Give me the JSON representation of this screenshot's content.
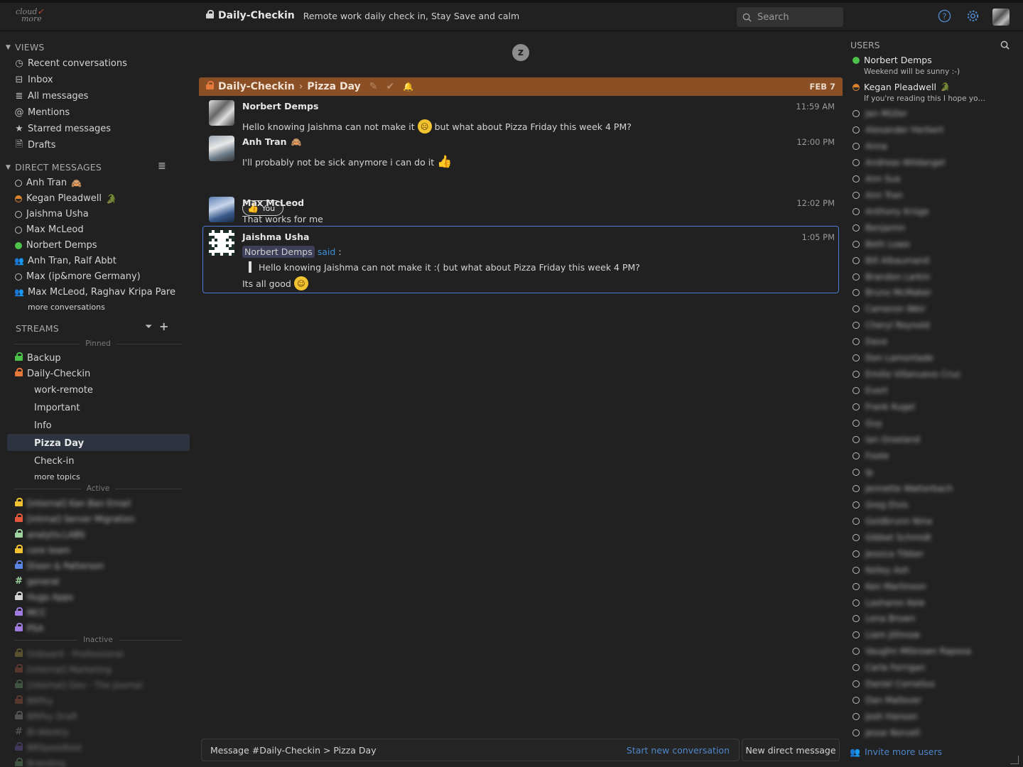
{
  "app": {
    "logo_line1": "cloud",
    "logo_line2": "more"
  },
  "header": {
    "stream_name": "Daily-Checkin",
    "stream_description": "Remote work  daily check in, Stay Save and calm",
    "search_placeholder": "Search"
  },
  "sidebar": {
    "views_title": "VIEWS",
    "views": [
      {
        "label": "Recent conversations",
        "icon": "clock-icon"
      },
      {
        "label": "Inbox",
        "icon": "inbox-icon"
      },
      {
        "label": "All messages",
        "icon": "list-icon"
      },
      {
        "label": "Mentions",
        "icon": "at-icon"
      },
      {
        "label": "Starred messages",
        "icon": "star-icon"
      },
      {
        "label": "Drafts",
        "icon": "draft-icon"
      }
    ],
    "dm_title": "DIRECT MESSAGES",
    "dms": [
      {
        "label": "Anh Tran",
        "status": "offline",
        "emoji": "🙈"
      },
      {
        "label": "Kegan Pleadwell",
        "status": "idle",
        "emoji": "🐊"
      },
      {
        "label": "Jaishma Usha",
        "status": "offline"
      },
      {
        "label": "Max McLeod",
        "status": "offline"
      },
      {
        "label": "Norbert Demps",
        "status": "active"
      },
      {
        "label": "Anh Tran, Ralf Abbt",
        "status": "group"
      },
      {
        "label": "Max (ip&more Germany)",
        "status": "offline"
      },
      {
        "label": "Max McLeod, Raghav Kripa Pare",
        "status": "group"
      }
    ],
    "more_conversations": "more conversations",
    "streams_title": "STREAMS",
    "pinned_label": "Pinned",
    "pinned_streams": [
      {
        "label": "Backup",
        "color": "#4cc24a"
      },
      {
        "label": "Daily-Checkin",
        "color": "#e5793a"
      }
    ],
    "topics": [
      "work-remote",
      "Important",
      "Info",
      "Pizza Day",
      "Check-in"
    ],
    "selected_topic": "Pizza Day",
    "more_topics": "more topics",
    "active_label": "Active",
    "active_streams": [
      {
        "label": "[internal] Kan Ban Email",
        "color": "#f2c230"
      },
      {
        "label": "[intrnal] Server Migration",
        "color": "#e5563a"
      },
      {
        "label": "analytiv.LABS",
        "color": "#9fd3a0"
      },
      {
        "label": "core team",
        "color": "#f2c230"
      },
      {
        "label": "Dixon & Patterson",
        "color": "#5b86e5"
      },
      {
        "label": "general",
        "color": "#9fd3a0",
        "hash": true
      },
      {
        "label": "Hugo Apps",
        "color": "#d4d4d4"
      },
      {
        "label": "MCC",
        "color": "#a07be0"
      },
      {
        "label": "PSA",
        "color": "#a07be0"
      }
    ],
    "inactive_label": "Inactive",
    "inactive_streams": [
      {
        "label": "Onboard - Professional",
        "color": "#8a7a3a"
      },
      {
        "label": "[internal] Marketing",
        "color": "#8a4a3a"
      },
      {
        "label": "[internal] Dev - The Journal",
        "color": "#5a7a5a"
      },
      {
        "label": "BRPsy",
        "color": "#8a4a3a"
      },
      {
        "label": "BRPsy Draft",
        "color": "#7a7a7a"
      },
      {
        "label": "Bi-Weekly",
        "color": "#7a7a7a",
        "hash": true
      },
      {
        "label": "BRSpeedtest",
        "color": "#5a4a8a"
      },
      {
        "label": "Branding",
        "color": "#5a7a5a"
      }
    ]
  },
  "recipient_bar": {
    "stream": "Daily-Checkin",
    "topic": "Pizza Day",
    "date": "FEB 7"
  },
  "messages": [
    {
      "sender": "Norbert Demps",
      "time": "11:59 AM",
      "text_before": "Hello knowing Jaishma can not make it",
      "text_after": "but what about Pizza Friday this week 4 PM?"
    },
    {
      "sender": "Anh Tran",
      "time": "12:00 PM",
      "text": "I'll probably not be sick anymore i can do it",
      "reaction_label": "You"
    },
    {
      "sender": "Max McLeod",
      "time": "12:02 PM",
      "text": "That works for me"
    },
    {
      "sender": "Jaishma Usha",
      "time": "1:05 PM",
      "mention": "Norbert Demps",
      "said": "said",
      "quote": "Hello knowing Jaishma can not make it :( but what about Pizza Friday this week 4 PM?",
      "text": "Its all good"
    }
  ],
  "compose": {
    "placeholder": "Message #Daily-Checkin > Pizza Day",
    "start_new": "Start new conversation",
    "new_dm": "New direct message"
  },
  "users_panel": {
    "title": "USERS",
    "users": [
      {
        "name": "Norbert Demps",
        "status": "active",
        "sub": "Weekend will be sunny :-)"
      },
      {
        "name": "Kegan Pleadwell",
        "status": "idle",
        "sub": "If you're reading this I hope yo…",
        "emoji": "🐊"
      }
    ],
    "offline_users": [
      "Jan Müller",
      "Alexander Herbert",
      "Anna",
      "Andreas Wildangel",
      "Ann Sue",
      "Ann Tran",
      "Anthony Krüge",
      "Benjamin",
      "Beth Lowe",
      "Bill Albaumanit",
      "Brandon Larkin",
      "Bruno McMaker",
      "Cameron Weir",
      "Cheryl Reynold",
      "Dave",
      "Don Lamontade",
      "Emilio Villanuevo Cruz",
      "Evert",
      "Frank Kugel",
      "Guy",
      "Ian Groeland",
      "Foote",
      "Ip",
      "Jennette Watterbach",
      "Greg Elvis",
      "Goldbrunn Nina",
      "Gibbet Schmidt",
      "Jessica Tibber",
      "Kelley Ash",
      "Ken Martinson",
      "Lasharon Kele",
      "Lena Brown",
      "Liam Jithnow",
      "Vaughn Mtbrown Raposa",
      "Carla Ferrigan",
      "Daniel Cornelius",
      "Dan Mallover",
      "Josh Hanson",
      "Jesse Norvell"
    ],
    "invite": "Invite more users"
  }
}
